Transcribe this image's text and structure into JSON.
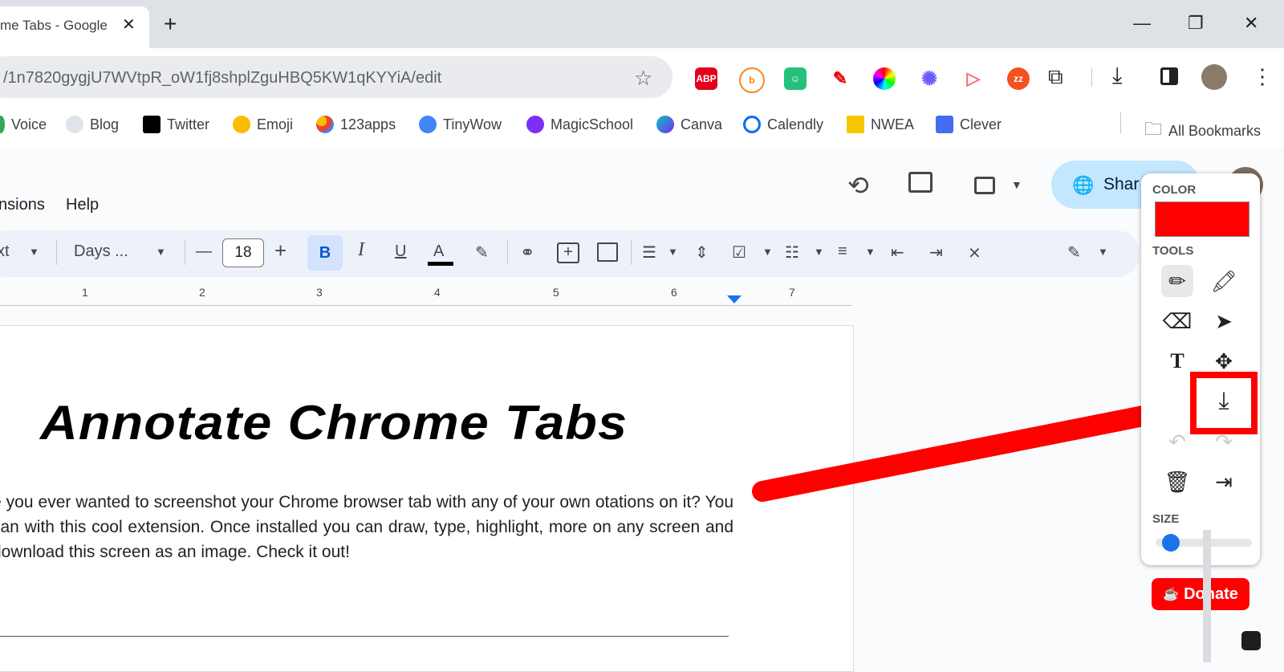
{
  "browser": {
    "tab_title": "me Tabs - Google",
    "tab_close": "✕",
    "new_tab": "+",
    "url": "/1n7820gygjU7WVtpR_oW1fj8shplZguHBQ5KW1qKYYiA/edit",
    "window": {
      "minimize": "—",
      "restore": "❐",
      "close": "✕"
    }
  },
  "extensions": [
    {
      "label": "ABP",
      "color": "#e3001b"
    },
    {
      "label": "b",
      "color": "#f08a24"
    },
    {
      "label": "☺",
      "color": "#23c17b"
    },
    {
      "label": "✎",
      "color": "#ffffff"
    },
    {
      "label": "◉",
      "color": "#ffffff"
    },
    {
      "label": "✺",
      "color": "#ffffff"
    },
    {
      "label": "▷",
      "color": "#ffffff"
    },
    {
      "label": "zz",
      "color": "#f4511e"
    }
  ],
  "bookmarks": [
    {
      "label": "Voice",
      "color": "#34a853"
    },
    {
      "label": "Blog",
      "color": "#9aa0a6"
    },
    {
      "label": "Twitter",
      "color": "#000000"
    },
    {
      "label": "Emoji",
      "color": "#fbbc04"
    },
    {
      "label": "123apps",
      "color": "#ea4335"
    },
    {
      "label": "TinyWow",
      "color": "#4285f4"
    },
    {
      "label": "MagicSchool",
      "color": "#7b2ff7"
    },
    {
      "label": "Canva",
      "color": "#00c4cc"
    },
    {
      "label": "Calendly",
      "color": "#006bff"
    },
    {
      "label": "NWEA",
      "color": "#f6c700"
    },
    {
      "label": "Clever",
      "color": "#436cf2"
    },
    {
      "label": "All Bookmarks",
      "color": "#5f6368"
    }
  ],
  "docs": {
    "menu": [
      "nsions",
      "Help"
    ],
    "share_label": "Shar",
    "toolbar": {
      "style": "xt",
      "font": "Days ...",
      "font_size": "18",
      "bold": "B",
      "italic": "I",
      "underline": "U",
      "text_color": "A"
    },
    "ruler": [
      "1",
      "2",
      "3",
      "4",
      "5",
      "6",
      "7"
    ],
    "title": "Annotate Chrome Tabs",
    "body": "e you ever wanted to screenshot your Chrome browser tab with any of your own otations on it? You can with this cool extension. Once installed you can draw, type, highlight, more on any screen and download this screen as an image. Check it out!"
  },
  "annotate_panel": {
    "color_label": "COLOR",
    "color_value": "#ff0000",
    "tools_label": "TOOLS",
    "size_label": "SIZE",
    "size_value": 0.1,
    "donate_label": "Donate"
  }
}
